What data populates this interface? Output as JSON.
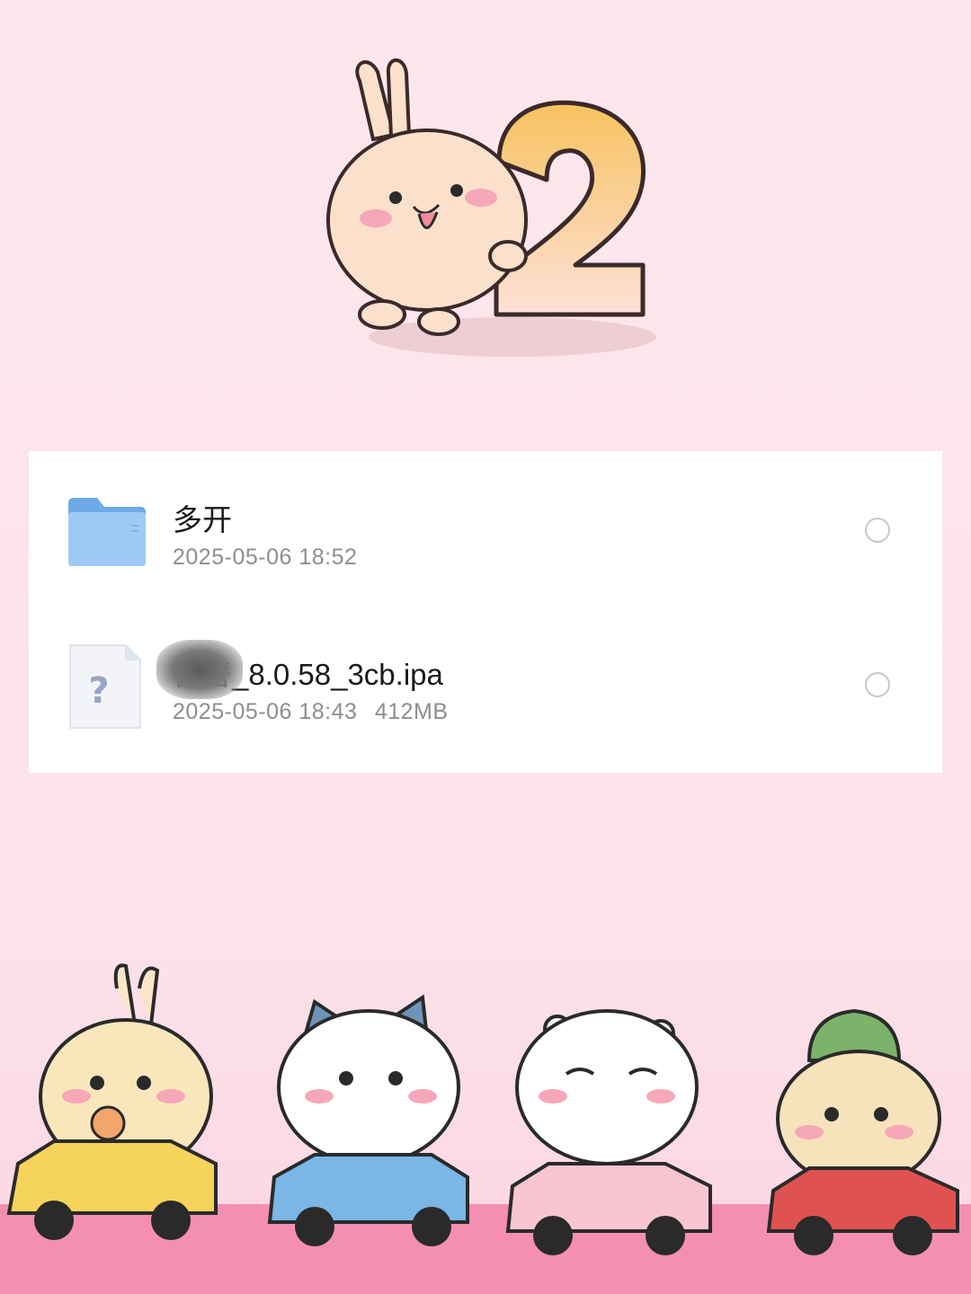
{
  "files": [
    {
      "name": "多开",
      "date": "2025-05-06 18:52",
      "size": "",
      "kind": "folder",
      "selected": false
    },
    {
      "name": "宫替_8.0.58_3cb.ipa",
      "date": "2025-05-06 18:43",
      "size": "412MB",
      "kind": "unknown-file",
      "selected": false
    }
  ],
  "decoration": {
    "header_number": "2",
    "colors": {
      "background": "#fde7ec",
      "bottom_band": "#f48fb1",
      "folder_blue": "#7fb8f2",
      "number_gold": "#f6c468",
      "meta_gray": "#8e8e93"
    },
    "icons": [
      "folder-icon",
      "unknown-file-icon",
      "radio-circle-icon"
    ]
  }
}
